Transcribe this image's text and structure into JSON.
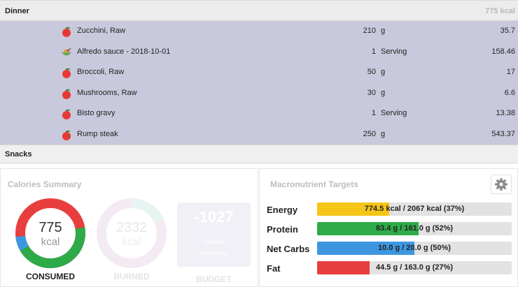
{
  "dinner": {
    "title": "Dinner",
    "kcal": "775 kcal",
    "items": [
      {
        "name": "Zucchini, Raw",
        "qty": "210",
        "unit": "g",
        "cal": "35.7",
        "icon": "apple-icon"
      },
      {
        "name": "Alfredo sauce - 2018-10-01",
        "qty": "1",
        "unit": "Serving",
        "cal": "158.46",
        "icon": "bowl-icon"
      },
      {
        "name": "Broccoli, Raw",
        "qty": "50",
        "unit": "g",
        "cal": "17",
        "icon": "apple-icon"
      },
      {
        "name": "Mushrooms, Raw",
        "qty": "30",
        "unit": "g",
        "cal": "6.6",
        "icon": "apple-icon"
      },
      {
        "name": "Bisto gravy",
        "qty": "1",
        "unit": "Serving",
        "cal": "13.38",
        "icon": "apple-icon"
      },
      {
        "name": "Rump steak",
        "qty": "250",
        "unit": "g",
        "cal": "543.37",
        "icon": "apple-icon"
      }
    ]
  },
  "snacks": {
    "title": "Snacks"
  },
  "calories_summary": {
    "title": "Calories Summary",
    "consumed": {
      "value": "775",
      "unit": "kcal",
      "label": "CONSUMED"
    },
    "burned": {
      "value": "2332",
      "unit": "kcal",
      "label": "BURNED"
    },
    "budget": {
      "value": "-1027",
      "line1": "Calories",
      "line2": "Remaining",
      "label": "BUDGET"
    }
  },
  "macros": {
    "title": "Macronutrient Targets",
    "gear_icon": "gear-icon",
    "rows": [
      {
        "label": "Energy",
        "text": "774.5 kcal / 2067 kcal (37%)",
        "fraction": 0.37,
        "color": "#f5c518"
      },
      {
        "label": "Protein",
        "text": "83.4 g / 161.0 g (52%)",
        "fraction": 0.52,
        "color": "#2eaa48"
      },
      {
        "label": "Net Carbs",
        "text": "10.0 g / 20.0 g (50%)",
        "fraction": 0.5,
        "color": "#3d97e0"
      },
      {
        "label": "Fat",
        "text": "44.5 g / 163.0 g (27%)",
        "fraction": 0.27,
        "color": "#e83e3e"
      }
    ]
  }
}
